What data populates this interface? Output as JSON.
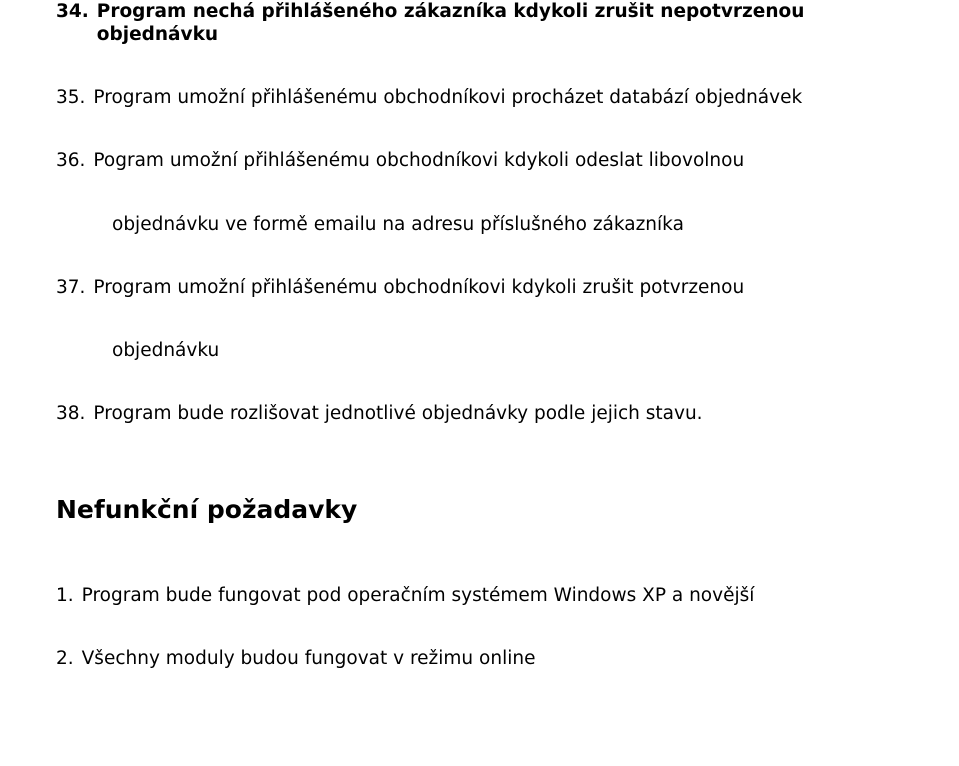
{
  "items": [
    {
      "num": "34.",
      "text": "Program nechá přihlášeného zákazníka kdykoli zrušit nepotvrzenou objednávku",
      "bold": true
    },
    {
      "num": "35.",
      "text": "Program umožní přihlášenému obchodníkovi procházet databází objednávek"
    },
    {
      "num": "36.",
      "text": "Pogram umožní přihlášenému obchodníkovi kdykoli odeslat libovolnou",
      "cont": "objednávku ve formě emailu na adresu příslušného zákazníka"
    },
    {
      "num": "37.",
      "text": "Program umožní přihlášenému obchodníkovi kdykoli zrušit potvrzenou",
      "cont": "objednávku"
    },
    {
      "num": "38.",
      "text": "Program bude rozlišovat jednotlivé objednávky podle jejich stavu."
    }
  ],
  "heading": "Nefunkční požadavky",
  "nf_items": [
    {
      "num": "1.",
      "text": "Program bude fungovat pod operačním systémem Windows XP a novější"
    },
    {
      "num": "2.",
      "text": "Všechny moduly budou fungovat v režimu online"
    }
  ]
}
